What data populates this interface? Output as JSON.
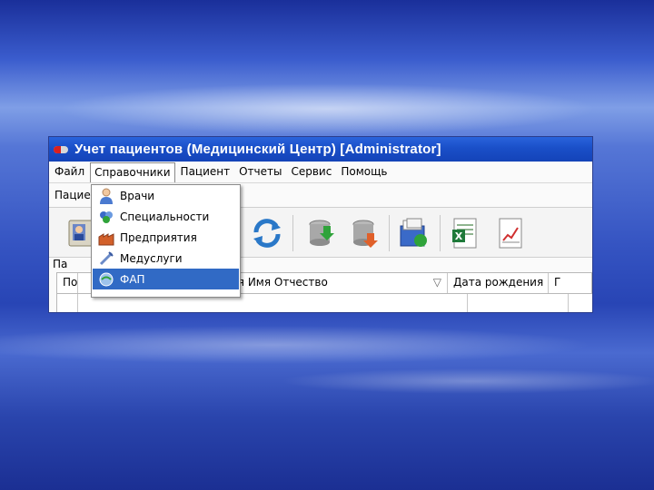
{
  "window": {
    "title": "Учет пациентов (Медицинский Центр) [Administrator]"
  },
  "menubar": {
    "items": [
      "Файл",
      "Справочники",
      "Пациент",
      "Отчеты",
      "Сервис",
      "Помощь"
    ],
    "open_item": "Справочники"
  },
  "tabs": {
    "active_tab_partial": "Пацие"
  },
  "group_label": "Па",
  "grid": {
    "columns": [
      "По",
      "…ия Имя Отчество",
      "Дата рождения",
      "Г"
    ]
  },
  "dropdown": {
    "items": [
      {
        "label": "Врачи",
        "icon": "doctor-icon"
      },
      {
        "label": "Специальности",
        "icon": "specialty-icon"
      },
      {
        "label": "Предприятия",
        "icon": "enterprise-icon"
      },
      {
        "label": "Медуслуги",
        "icon": "med-service-icon"
      },
      {
        "label": "ФАП",
        "icon": "fap-icon"
      }
    ],
    "selected": "ФАП"
  },
  "colors": {
    "titlebar": "#1a4fc8",
    "selection": "#316ac5",
    "window_bg": "#ece9d8"
  }
}
